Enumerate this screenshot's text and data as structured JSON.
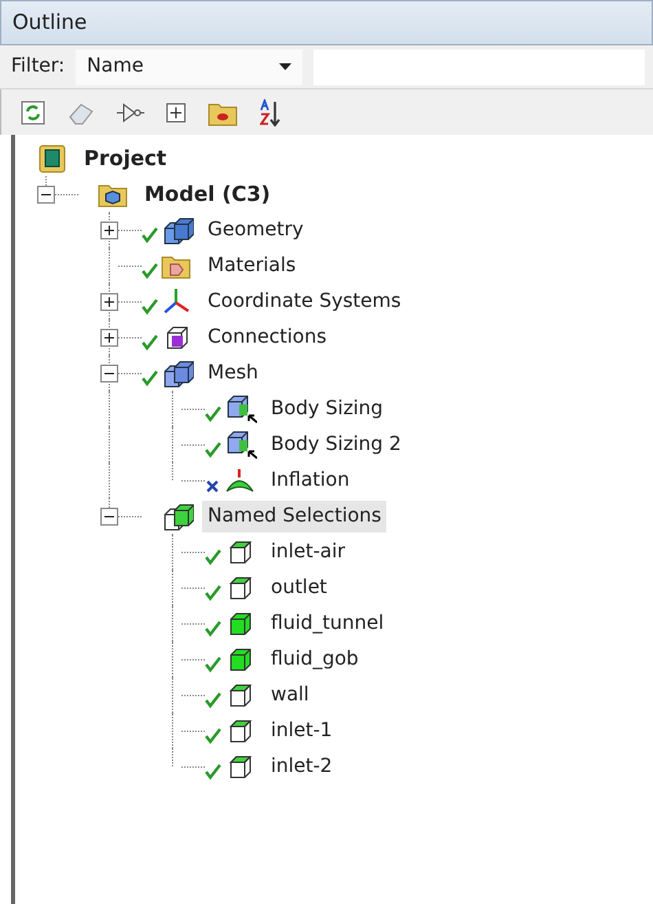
{
  "panel": {
    "title": "Outline"
  },
  "filter": {
    "label": "Filter:",
    "value": "Name"
  },
  "tree": [
    {
      "label": "Project",
      "bold": true,
      "kind": "project",
      "selected": false,
      "children": [
        {
          "label": "Model (C3)",
          "bold": true,
          "kind": "model",
          "expanded": true,
          "selected": false,
          "children": [
            {
              "label": "Geometry",
              "kind": "geometry",
              "checked": true,
              "expanded": false,
              "selected": false
            },
            {
              "label": "Materials",
              "kind": "materials",
              "checked": true,
              "selected": false
            },
            {
              "label": "Coordinate Systems",
              "kind": "axes",
              "checked": true,
              "expanded": false,
              "selected": false
            },
            {
              "label": "Connections",
              "kind": "connections",
              "checked": true,
              "expanded": false,
              "selected": false
            },
            {
              "label": "Mesh",
              "kind": "mesh",
              "checked": true,
              "expanded": true,
              "selected": false,
              "children": [
                {
                  "label": "Body Sizing",
                  "kind": "sizing",
                  "checked": true,
                  "selected": false
                },
                {
                  "label": "Body Sizing 2",
                  "kind": "sizing",
                  "checked": true,
                  "selected": false
                },
                {
                  "label": "Inflation",
                  "kind": "inflation",
                  "checked": false,
                  "failed": true,
                  "selected": false
                }
              ]
            },
            {
              "label": "Named Selections",
              "kind": "named",
              "expanded": true,
              "selected": true,
              "children": [
                {
                  "label": "inlet-air",
                  "kind": "face",
                  "checked": true,
                  "selected": false
                },
                {
                  "label": "outlet",
                  "kind": "face",
                  "checked": true,
                  "selected": false
                },
                {
                  "label": "fluid_tunnel",
                  "kind": "body",
                  "checked": true,
                  "selected": false
                },
                {
                  "label": "fluid_gob",
                  "kind": "body",
                  "checked": true,
                  "selected": false
                },
                {
                  "label": "wall",
                  "kind": "face",
                  "checked": true,
                  "selected": false
                },
                {
                  "label": "inlet-1",
                  "kind": "face",
                  "checked": true,
                  "selected": false
                },
                {
                  "label": "inlet-2",
                  "kind": "face",
                  "checked": true,
                  "selected": false
                }
              ]
            }
          ]
        }
      ]
    }
  ]
}
